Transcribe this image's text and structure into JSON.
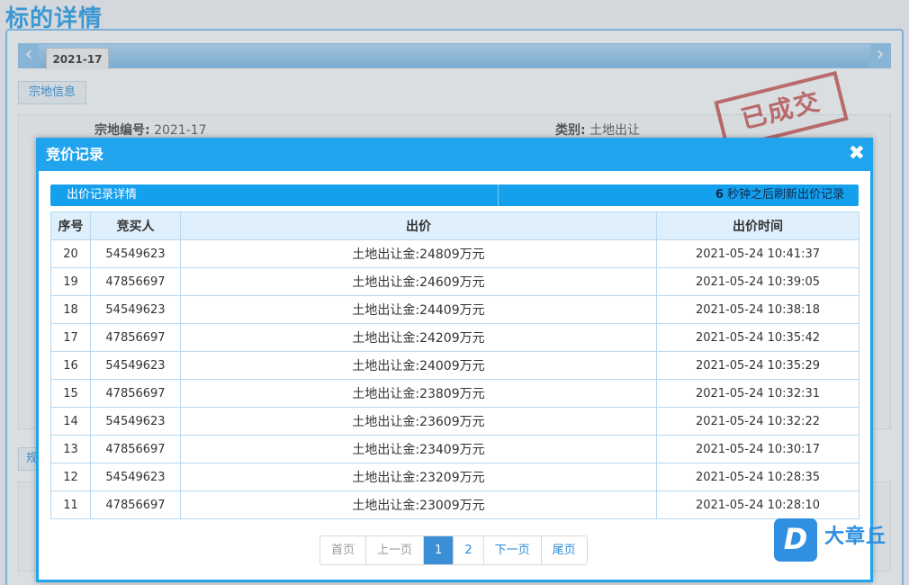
{
  "page": {
    "title": "标的详情"
  },
  "tabs": {
    "active": "2021-17",
    "prev_icon": "chevron-left-icon",
    "next_icon": "chevron-right-icon"
  },
  "section": {
    "land_info": "宗地信息",
    "second_label": "规"
  },
  "info": {
    "lot_no_key": "宗地编号:",
    "lot_no_value": "2021-17",
    "category_key": "类别:",
    "category_value": "土地出让"
  },
  "stamp": {
    "text": "已成交"
  },
  "modal": {
    "title": "竞价记录",
    "close_icon": "close-icon",
    "sub_left": "出价记录详情",
    "sub_right_count": "6",
    "sub_right_text": " 秒钟之后刷新出价记录",
    "columns": [
      "序号",
      "竞买人",
      "出价",
      "出价时间"
    ],
    "rows": [
      {
        "no": "20",
        "bidder": "54549623",
        "price": "土地出让金:24809万元",
        "time": "2021-05-24 10:41:37"
      },
      {
        "no": "19",
        "bidder": "47856697",
        "price": "土地出让金:24609万元",
        "time": "2021-05-24 10:39:05"
      },
      {
        "no": "18",
        "bidder": "54549623",
        "price": "土地出让金:24409万元",
        "time": "2021-05-24 10:38:18"
      },
      {
        "no": "17",
        "bidder": "47856697",
        "price": "土地出让金:24209万元",
        "time": "2021-05-24 10:35:42"
      },
      {
        "no": "16",
        "bidder": "54549623",
        "price": "土地出让金:24009万元",
        "time": "2021-05-24 10:35:29"
      },
      {
        "no": "15",
        "bidder": "47856697",
        "price": "土地出让金:23809万元",
        "time": "2021-05-24 10:32:31"
      },
      {
        "no": "14",
        "bidder": "54549623",
        "price": "土地出让金:23609万元",
        "time": "2021-05-24 10:32:22"
      },
      {
        "no": "13",
        "bidder": "47856697",
        "price": "土地出让金:23409万元",
        "time": "2021-05-24 10:30:17"
      },
      {
        "no": "12",
        "bidder": "54549623",
        "price": "土地出让金:23209万元",
        "time": "2021-05-24 10:28:35"
      },
      {
        "no": "11",
        "bidder": "47856697",
        "price": "土地出让金:23009万元",
        "time": "2021-05-24 10:28:10"
      }
    ],
    "pager": {
      "first": "首页",
      "prev": "上一页",
      "page1": "1",
      "page2": "2",
      "next": "下一页",
      "last": "尾页"
    }
  },
  "watermark": {
    "badge": "D",
    "text": "大章丘"
  },
  "colors": {
    "accent": "#21a4ee",
    "stamp": "#c0302c",
    "header_bg": "#dff0fc"
  }
}
